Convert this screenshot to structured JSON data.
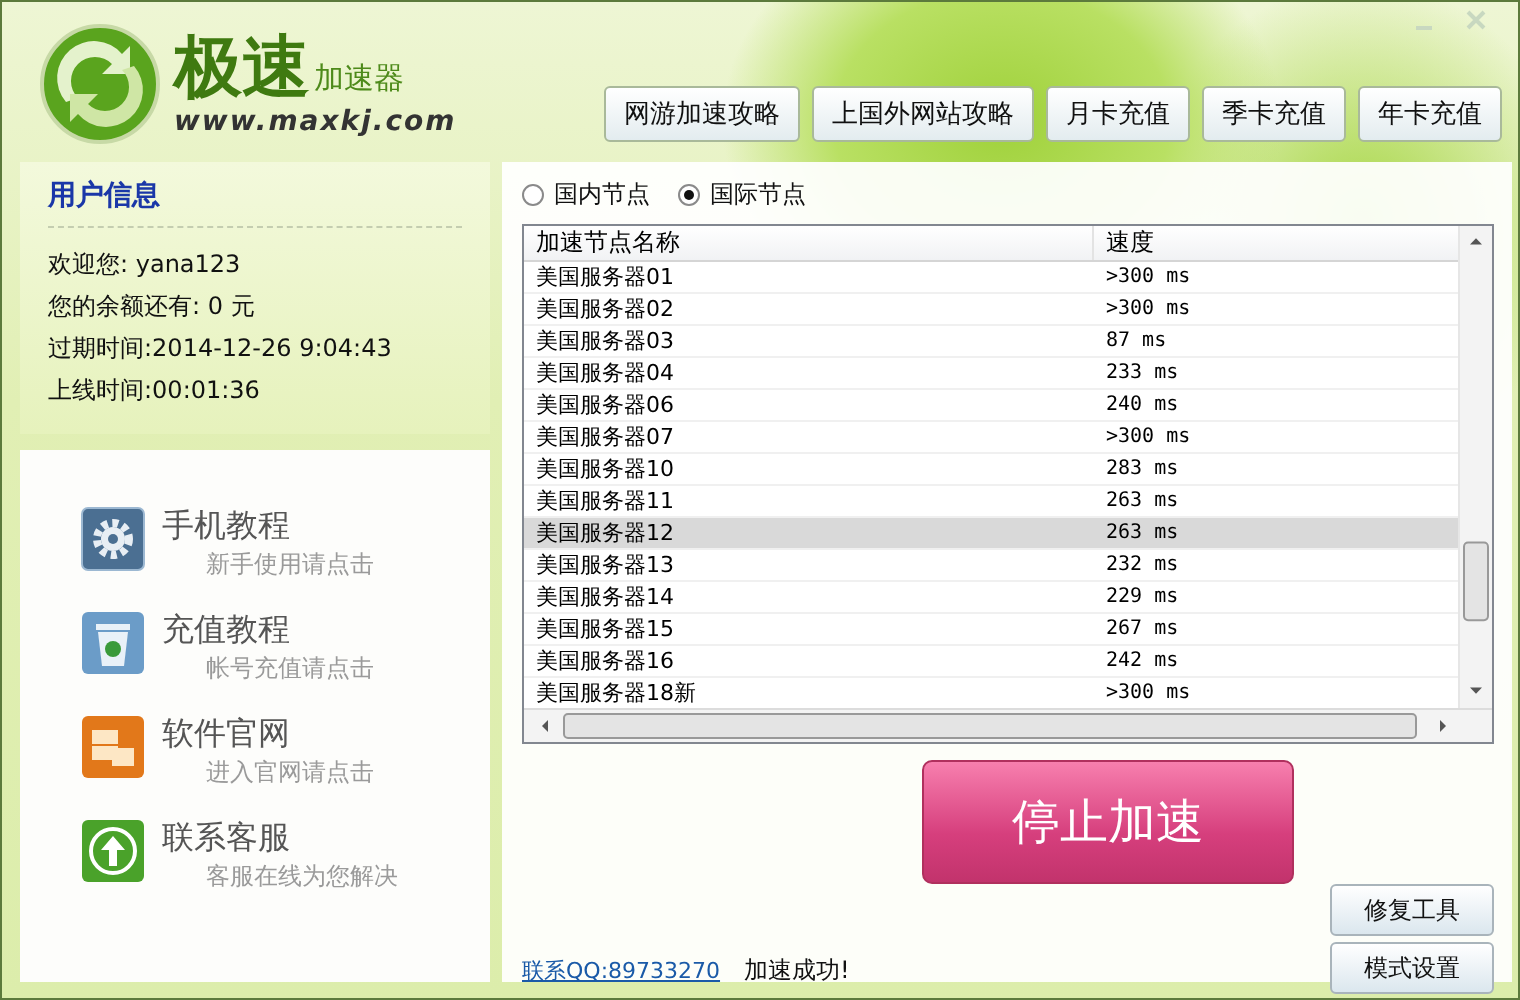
{
  "logo": {
    "title": "极速",
    "subtitle": "加速器",
    "url": "www.maxkj.com"
  },
  "top_buttons": [
    "网游加速攻略",
    "上国外网站攻略",
    "月卡充值",
    "季卡充值",
    "年卡充值"
  ],
  "user_info": {
    "title": "用户信息",
    "lines": [
      "欢迎您: yana123",
      "您的余额还有: 0 元",
      "过期时间:2014-12-26 9:04:43",
      "上线时间:00:01:36"
    ]
  },
  "menu": [
    {
      "kind": "gear",
      "title": "手机教程",
      "subtitle": "新手使用请点击"
    },
    {
      "kind": "bin",
      "title": "充值教程",
      "subtitle": "帐号充值请点击"
    },
    {
      "kind": "blocks",
      "title": "软件官网",
      "subtitle": "进入官网请点击"
    },
    {
      "kind": "arrow",
      "title": "联系客服",
      "subtitle": "客服在线为您解决"
    }
  ],
  "node_types": [
    {
      "label": "国内节点",
      "selected": false
    },
    {
      "label": "国际节点",
      "selected": true
    }
  ],
  "table": {
    "columns": [
      "加速节点名称",
      "速度"
    ],
    "rows": [
      {
        "name": "美国服务器01",
        "speed": ">300 ms",
        "selected": false
      },
      {
        "name": "美国服务器02",
        "speed": ">300 ms",
        "selected": false
      },
      {
        "name": "美国服务器03",
        "speed": "87 ms",
        "selected": false
      },
      {
        "name": "美国服务器04",
        "speed": "233 ms",
        "selected": false
      },
      {
        "name": "美国服务器06",
        "speed": "240 ms",
        "selected": false
      },
      {
        "name": "美国服务器07",
        "speed": ">300 ms",
        "selected": false
      },
      {
        "name": "美国服务器10",
        "speed": "283 ms",
        "selected": false
      },
      {
        "name": "美国服务器11",
        "speed": "263 ms",
        "selected": false
      },
      {
        "name": "美国服务器12",
        "speed": "263 ms",
        "selected": true
      },
      {
        "name": "美国服务器13",
        "speed": "232 ms",
        "selected": false
      },
      {
        "name": "美国服务器14",
        "speed": "229 ms",
        "selected": false
      },
      {
        "name": "美国服务器15",
        "speed": "267 ms",
        "selected": false
      },
      {
        "name": "美国服务器16",
        "speed": "242 ms",
        "selected": false
      },
      {
        "name": "美国服务器18新",
        "speed": ">300 ms",
        "selected": false
      }
    ]
  },
  "stop_button": "停止加速",
  "contact_link": "联系QQ:89733270",
  "status": "加速成功!",
  "side_buttons": [
    "修复工具",
    "模式设置"
  ]
}
